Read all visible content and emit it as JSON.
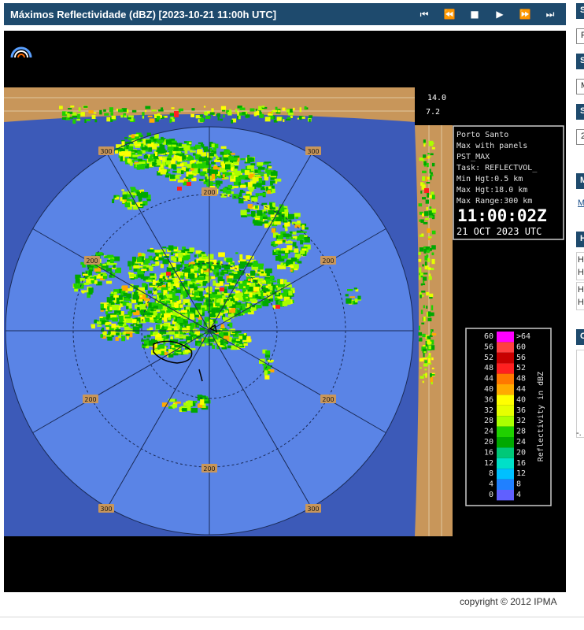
{
  "header": {
    "title": "Máximos Reflectividade (dBZ) [2023-10-21 11:00h UTC]",
    "controls": [
      {
        "name": "first-frame",
        "glyph": "⏮"
      },
      {
        "name": "previous-frame",
        "glyph": "⏪"
      },
      {
        "name": "stop",
        "glyph": "■"
      },
      {
        "name": "play",
        "glyph": "▶"
      },
      {
        "name": "next-frame",
        "glyph": "⏩"
      },
      {
        "name": "last-frame",
        "glyph": "⏭"
      }
    ]
  },
  "radar": {
    "panel_labels": {
      "top": "14.0",
      "mid": "7.2"
    },
    "range_labels": [
      "300",
      "200"
    ],
    "info": {
      "station": "Porto Santo",
      "product": "Max with panels",
      "code": "PST_MAX",
      "task": "Task: REFLECTVOL_",
      "min_hgt": "Min Hgt:0.5 km",
      "max_hgt": "Max Hgt:18.0 km",
      "max_range": "Max Range:300 km",
      "time": "11:00:02Z",
      "date": "21 OCT 2023 UTC"
    },
    "legend": {
      "left_labels": [
        "60",
        "56",
        "52",
        "48",
        "44",
        "40",
        "36",
        "32",
        "28",
        "24",
        "20",
        "16",
        "12",
        "8",
        "4",
        "0"
      ],
      "right_labels": [
        ">64",
        "60",
        "56",
        "52",
        "48",
        "44",
        "40",
        "36",
        "32",
        "28",
        "24",
        "20",
        "16",
        "12",
        "8",
        "4"
      ],
      "colors": [
        "#ff00ff",
        "#ff4040",
        "#c80000",
        "#ff2020",
        "#ff7800",
        "#ffaa00",
        "#ffff00",
        "#e6ff00",
        "#aaff00",
        "#20d000",
        "#00a800",
        "#00c878",
        "#00e0c8",
        "#00c0ff",
        "#2080ff",
        "#6060ff"
      ],
      "axis_label": "Reflectivity in dBZ"
    },
    "colors": {
      "radar_disc": "#5a84e6",
      "radar_background": "#3c5ab8",
      "panel": "#c8965a",
      "viewer_background": "#000000"
    }
  },
  "footer": {
    "copyright": "copyright © 2012 IPMA"
  },
  "sidebar": {
    "headings": [
      "S",
      "S",
      "S",
      "M",
      "H",
      "C"
    ],
    "boxes": [
      "F",
      "M",
      "2"
    ],
    "link": "M",
    "text_rows": [
      "H",
      "H",
      "H",
      "H"
    ],
    "bottom_text": "-."
  }
}
